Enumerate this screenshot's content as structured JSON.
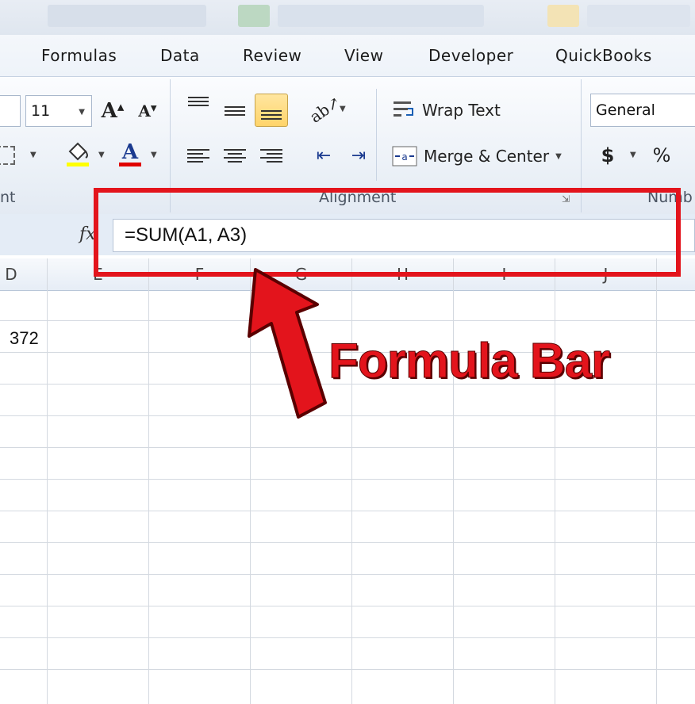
{
  "ribbon": {
    "tabs": [
      "Formulas",
      "Data",
      "Review",
      "View",
      "Developer",
      "QuickBooks"
    ],
    "font_size_value": "11",
    "wrap_text_label": "Wrap Text",
    "merge_center_label": "Merge & Center",
    "number_format_value": "General",
    "group_labels": {
      "font_partial": "nt",
      "alignment": "Alignment",
      "number_partial": "Numb"
    },
    "currency_symbol": "$",
    "percent_symbol": "%",
    "font_color": "#e00000",
    "fill_color": "#ffff00"
  },
  "formula_bar": {
    "fx_label": "fx",
    "formula": "=SUM(A1, A3)"
  },
  "sheet": {
    "column_headers": [
      "D",
      "E",
      "F",
      "G",
      "H",
      "I",
      "J"
    ],
    "cells": {
      "D2": "372"
    }
  },
  "annotation": {
    "callout_text": "Formula Bar",
    "color": "#e3141c"
  }
}
